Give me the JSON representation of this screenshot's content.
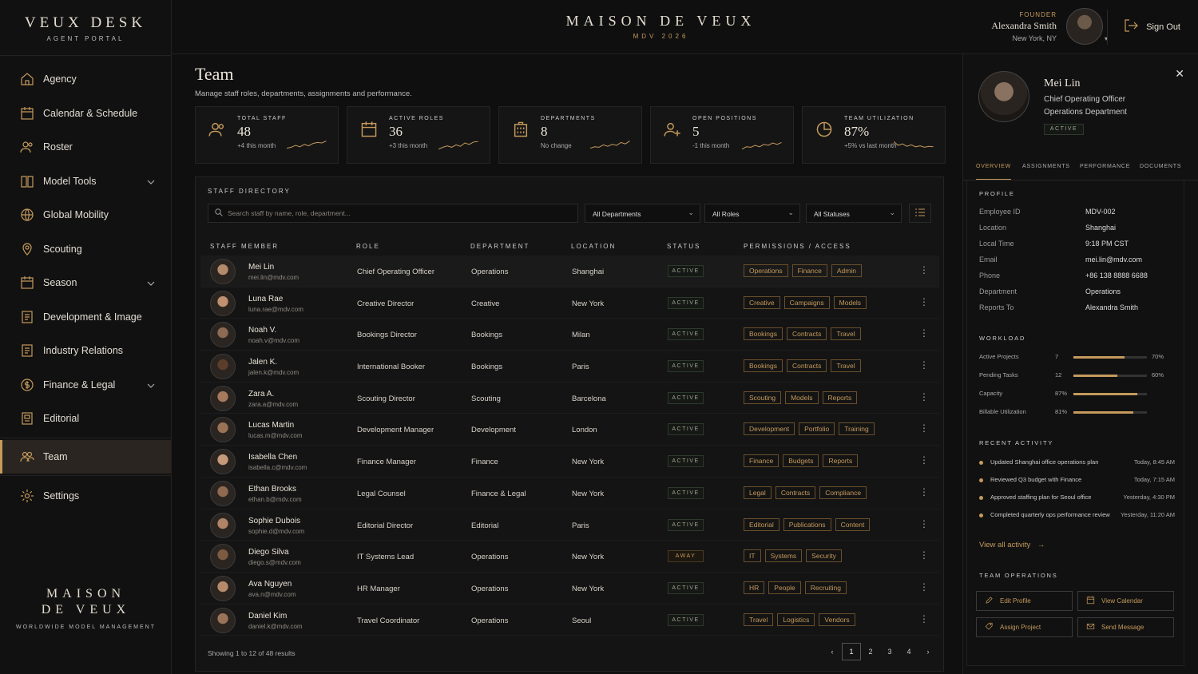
{
  "brand": {
    "title": "VEUX DESK",
    "subtitle": "AGENT PORTAL",
    "footer_line1": "MAISON",
    "footer_line2": "DE VEUX",
    "footer_tag": "WORLDWIDE MODEL MANAGEMENT"
  },
  "nav": [
    {
      "label": "Agency",
      "icon": "home-icon"
    },
    {
      "label": "Calendar & Schedule",
      "icon": "calendar-icon"
    },
    {
      "label": "Roster",
      "icon": "users-icon"
    },
    {
      "label": "Model Tools",
      "icon": "book-icon",
      "expand": true
    },
    {
      "label": "Global Mobility",
      "icon": "globe-icon"
    },
    {
      "label": "Scouting",
      "icon": "pin-icon"
    },
    {
      "label": "Season",
      "icon": "calendar-icon",
      "expand": true
    },
    {
      "label": "Development & Image",
      "icon": "document-icon"
    },
    {
      "label": "Industry Relations",
      "icon": "document-icon"
    },
    {
      "label": "Finance & Legal",
      "icon": "dollar-icon",
      "expand": true
    },
    {
      "label": "Editorial",
      "icon": "editorial-icon"
    },
    {
      "label": "Team",
      "icon": "team-icon",
      "active": true
    },
    {
      "label": "Settings",
      "icon": "gear-icon"
    }
  ],
  "header": {
    "title": "MAISON DE VEUX",
    "subtitle": "MDV 2026",
    "user_role": "FOUNDER",
    "user_name": "Alexandra Smith",
    "user_location": "New York, NY",
    "sign_out": "Sign Out"
  },
  "page": {
    "title": "Team",
    "subtitle": "Manage staff roles, departments, assignments and performance."
  },
  "stats": [
    {
      "label": "TOTAL STAFF",
      "value": "48",
      "delta": "+4 this month",
      "icon": "users-icon"
    },
    {
      "label": "ACTIVE ROLES",
      "value": "36",
      "delta": "+3 this month",
      "icon": "calendar-icon"
    },
    {
      "label": "DEPARTMENTS",
      "value": "8",
      "delta": "No change",
      "icon": "building-icon"
    },
    {
      "label": "OPEN POSITIONS",
      "value": "5",
      "delta": "-1 this month",
      "icon": "add-user-icon"
    },
    {
      "label": "TEAM UTILIZATION",
      "value": "87%",
      "delta": "+5% vs last month",
      "icon": "pie-icon"
    }
  ],
  "directory": {
    "title": "STAFF DIRECTORY",
    "search_placeholder": "Search staff by name, role, department...",
    "filter_department": "All Departments",
    "filter_role": "All Roles",
    "filter_status": "All Statuses",
    "columns": [
      "STAFF MEMBER",
      "ROLE",
      "DEPARTMENT",
      "LOCATION",
      "STATUS",
      "PERMISSIONS / ACCESS"
    ],
    "rows": [
      {
        "name": "Mei Lin",
        "email": "mei.lin@mdv.com",
        "role": "Chief Operating Officer",
        "dept": "Operations",
        "loc": "Shanghai",
        "status": "ACTIVE",
        "perms": [
          "Operations",
          "Finance",
          "Admin"
        ]
      },
      {
        "name": "Luna Rae",
        "email": "luna.rae@mdv.com",
        "role": "Creative Director",
        "dept": "Creative",
        "loc": "New York",
        "status": "ACTIVE",
        "perms": [
          "Creative",
          "Campaigns",
          "Models"
        ]
      },
      {
        "name": "Noah V.",
        "email": "noah.v@mdv.com",
        "role": "Bookings Director",
        "dept": "Bookings",
        "loc": "Milan",
        "status": "ACTIVE",
        "perms": [
          "Bookings",
          "Contracts",
          "Travel"
        ]
      },
      {
        "name": "Jalen K.",
        "email": "jalen.k@mdv.com",
        "role": "International Booker",
        "dept": "Bookings",
        "loc": "Paris",
        "status": "ACTIVE",
        "perms": [
          "Bookings",
          "Contracts",
          "Travel"
        ]
      },
      {
        "name": "Zara A.",
        "email": "zara.a@mdv.com",
        "role": "Scouting Director",
        "dept": "Scouting",
        "loc": "Barcelona",
        "status": "ACTIVE",
        "perms": [
          "Scouting",
          "Models",
          "Reports"
        ]
      },
      {
        "name": "Lucas Martin",
        "email": "lucas.m@mdv.com",
        "role": "Development Manager",
        "dept": "Development",
        "loc": "London",
        "status": "ACTIVE",
        "perms": [
          "Development",
          "Portfolio",
          "Training"
        ]
      },
      {
        "name": "Isabella Chen",
        "email": "isabella.c@mdv.com",
        "role": "Finance Manager",
        "dept": "Finance",
        "loc": "New York",
        "status": "ACTIVE",
        "perms": [
          "Finance",
          "Budgets",
          "Reports"
        ]
      },
      {
        "name": "Ethan Brooks",
        "email": "ethan.b@mdv.com",
        "role": "Legal Counsel",
        "dept": "Finance & Legal",
        "loc": "New York",
        "status": "ACTIVE",
        "perms": [
          "Legal",
          "Contracts",
          "Compliance"
        ]
      },
      {
        "name": "Sophie Dubois",
        "email": "sophie.d@mdv.com",
        "role": "Editorial Director",
        "dept": "Editorial",
        "loc": "Paris",
        "status": "ACTIVE",
        "perms": [
          "Editorial",
          "Publications",
          "Content"
        ]
      },
      {
        "name": "Diego Silva",
        "email": "diego.s@mdv.com",
        "role": "IT Systems Lead",
        "dept": "Operations",
        "loc": "New York",
        "status": "AWAY",
        "perms": [
          "IT",
          "Systems",
          "Security"
        ]
      },
      {
        "name": "Ava Nguyen",
        "email": "ava.n@mdv.com",
        "role": "HR Manager",
        "dept": "Operations",
        "loc": "New York",
        "status": "ACTIVE",
        "perms": [
          "HR",
          "People",
          "Recruiting"
        ]
      },
      {
        "name": "Daniel Kim",
        "email": "daniel.k@mdv.com",
        "role": "Travel Coordinator",
        "dept": "Operations",
        "loc": "Seoul",
        "status": "ACTIVE",
        "perms": [
          "Travel",
          "Logistics",
          "Vendors"
        ]
      }
    ],
    "showing": "Showing 1 to 12 of 48 results",
    "pages": [
      "1",
      "2",
      "3",
      "4"
    ]
  },
  "detail": {
    "name": "Mei Lin",
    "title": "Chief Operating Officer",
    "department": "Operations Department",
    "status": "ACTIVE",
    "tabs": [
      "OVERVIEW",
      "ASSIGNMENTS",
      "PERFORMANCE",
      "DOCUMENTS"
    ],
    "profile_label": "PROFILE",
    "profile": [
      {
        "k": "Employee ID",
        "v": "MDV-002"
      },
      {
        "k": "Location",
        "v": "Shanghai"
      },
      {
        "k": "Local Time",
        "v": "9:18 PM CST"
      },
      {
        "k": "Email",
        "v": "mei.lin@mdv.com"
      },
      {
        "k": "Phone",
        "v": "+86 138 8888 6688"
      },
      {
        "k": "Department",
        "v": "Operations"
      },
      {
        "k": "Reports To",
        "v": "Alexandra Smith"
      }
    ],
    "workload_label": "WORKLOAD",
    "workload": [
      {
        "k": "Active Projects",
        "n": "7",
        "pct": "70%",
        "fill": 0.7
      },
      {
        "k": "Pending Tasks",
        "n": "12",
        "pct": "60%",
        "fill": 0.6
      },
      {
        "k": "Capacity",
        "n": "87%",
        "pct": "",
        "fill": 0.87
      },
      {
        "k": "Billable Utilization",
        "n": "81%",
        "pct": "",
        "fill": 0.81
      }
    ],
    "activity_label": "RECENT ACTIVITY",
    "activity": [
      {
        "text": "Updated Shanghai office operations plan",
        "time": "Today, 8:45 AM"
      },
      {
        "text": "Reviewed Q3 budget with Finance",
        "time": "Today, 7:15 AM"
      },
      {
        "text": "Approved staffing plan for Seoul office",
        "time": "Yesterday, 4:30 PM"
      },
      {
        "text": "Completed quarterly ops performance review",
        "time": "Yesterday, 11:20 AM"
      }
    ],
    "view_all": "View all activity",
    "ops_label": "TEAM OPERATIONS",
    "ops": [
      {
        "label": "Edit Profile",
        "icon": "edit-icon"
      },
      {
        "label": "View Calendar",
        "icon": "calendar-icon"
      },
      {
        "label": "Assign Project",
        "icon": "tag-icon"
      },
      {
        "label": "Send Message",
        "icon": "mail-icon"
      }
    ]
  },
  "colors": {
    "accent": "#c59a5c",
    "bg": "#0f0f0f",
    "active_status": "#9ba88f"
  }
}
